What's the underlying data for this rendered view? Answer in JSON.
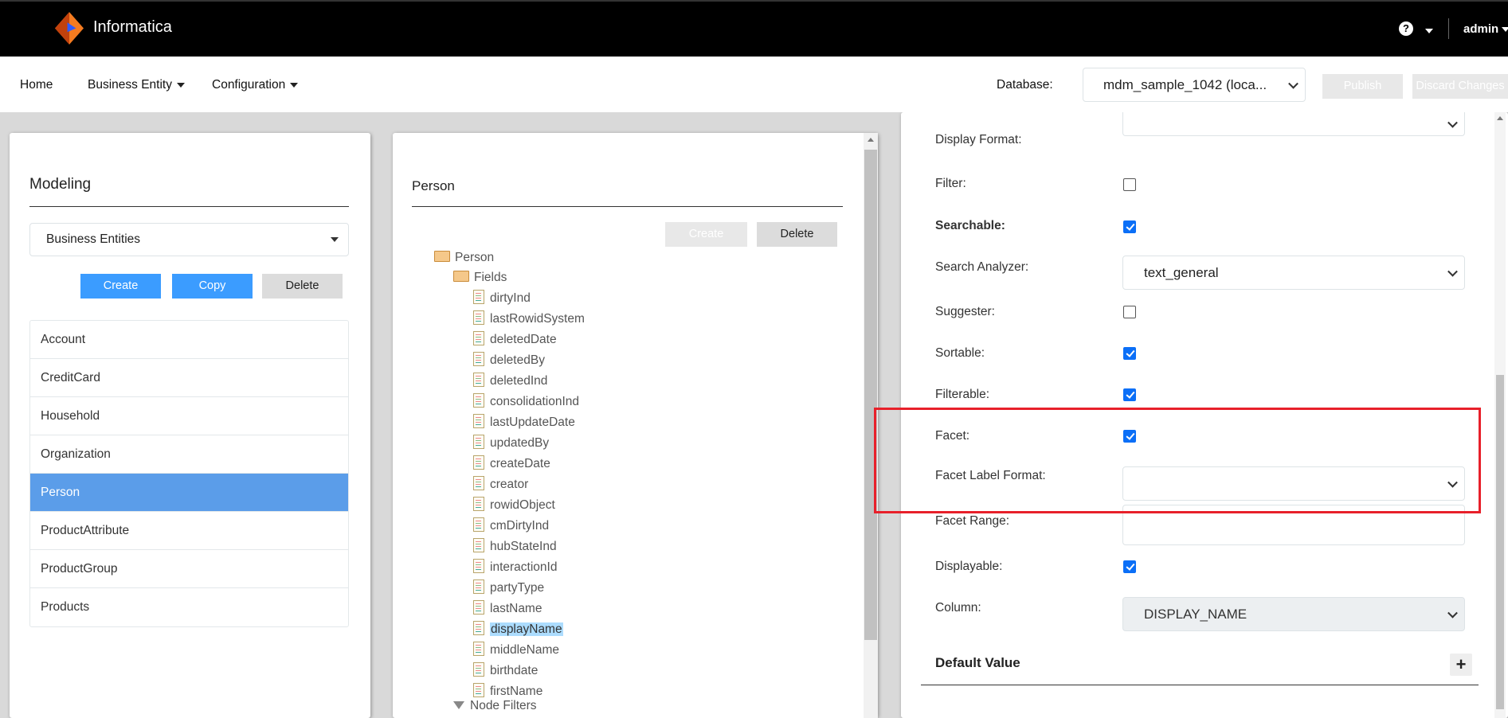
{
  "header": {
    "brand": "Informatica",
    "user": "admin",
    "colors": {
      "bar": "#000000",
      "logo": "#f47b20"
    }
  },
  "nav": {
    "items": [
      {
        "label": "Home"
      },
      {
        "label": "Business Entity"
      },
      {
        "label": "Configuration"
      }
    ],
    "database_label": "Database:",
    "database_value": "mdm_sample_1042 (loca...",
    "publish": "Publish",
    "discard": "Discard Changes"
  },
  "left": {
    "title": "Modeling",
    "selector": "Business Entities",
    "buttons": {
      "create": "Create",
      "copy": "Copy",
      "delete": "Delete"
    },
    "items": [
      "Account",
      "CreditCard",
      "Household",
      "Organization",
      "Person",
      "ProductAttribute",
      "ProductGroup",
      "Products"
    ],
    "selected": "Person",
    "accent": "#5b9de9"
  },
  "middle": {
    "title": "Person",
    "buttons": {
      "create": "Create",
      "delete": "Delete"
    },
    "tree": {
      "root": "Person",
      "fields_label": "Fields",
      "fields": [
        "dirtyInd",
        "lastRowidSystem",
        "deletedDate",
        "deletedBy",
        "deletedInd",
        "consolidationInd",
        "lastUpdateDate",
        "updatedBy",
        "createDate",
        "creator",
        "rowidObject",
        "cmDirtyInd",
        "hubStateInd",
        "interactionId",
        "partyType",
        "lastName",
        "displayName",
        "middleName",
        "birthdate",
        "firstName"
      ],
      "selected": "displayName",
      "node_filters": "Node Filters"
    }
  },
  "right": {
    "display_format": {
      "label": "Display Format:",
      "value": ""
    },
    "filter": {
      "label": "Filter:",
      "checked": false
    },
    "searchable": {
      "label": "Searchable:",
      "checked": true
    },
    "search_analyzer": {
      "label": "Search Analyzer:",
      "value": "text_general"
    },
    "suggester": {
      "label": "Suggester:",
      "checked": false
    },
    "sortable": {
      "label": "Sortable:",
      "checked": true
    },
    "filterable": {
      "label": "Filterable:",
      "checked": true
    },
    "facet": {
      "label": "Facet:",
      "checked": true
    },
    "facet_label_format": {
      "label": "Facet Label Format:",
      "value": ""
    },
    "facet_range": {
      "label": "Facet Range:",
      "value": ""
    },
    "displayable": {
      "label": "Displayable:",
      "checked": true
    },
    "column": {
      "label": "Column:",
      "value": "DISPLAY_NAME"
    },
    "default_value": {
      "label": "Default Value"
    },
    "highlight_color": "#e8202a"
  }
}
